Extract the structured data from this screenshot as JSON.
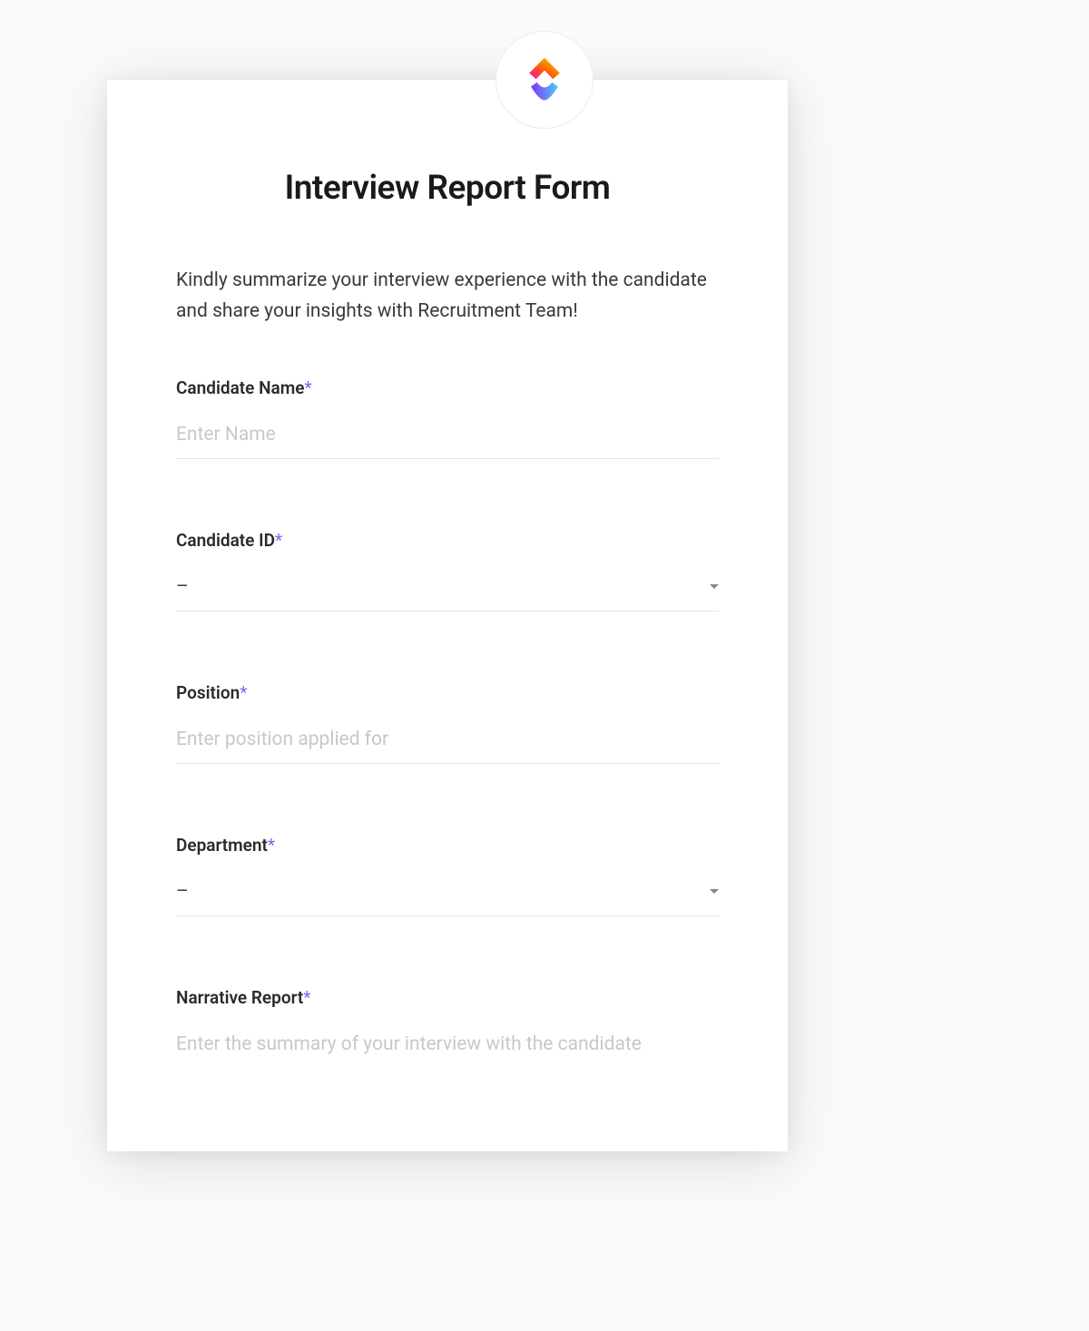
{
  "form": {
    "title": "Interview Report Form",
    "description": "Kindly summarize your interview experience with the candidate and share your insights with Recruitment Team!",
    "required_mark": "*",
    "fields": {
      "candidate_name": {
        "label": "Candidate Name",
        "placeholder": "Enter Name"
      },
      "candidate_id": {
        "label": "Candidate ID",
        "value": "–"
      },
      "position": {
        "label": "Position",
        "placeholder": "Enter position applied for"
      },
      "department": {
        "label": "Department",
        "value": "–"
      },
      "narrative_report": {
        "label": "Narrative Report",
        "placeholder": "Enter the summary of your interview with the candidate"
      }
    }
  }
}
